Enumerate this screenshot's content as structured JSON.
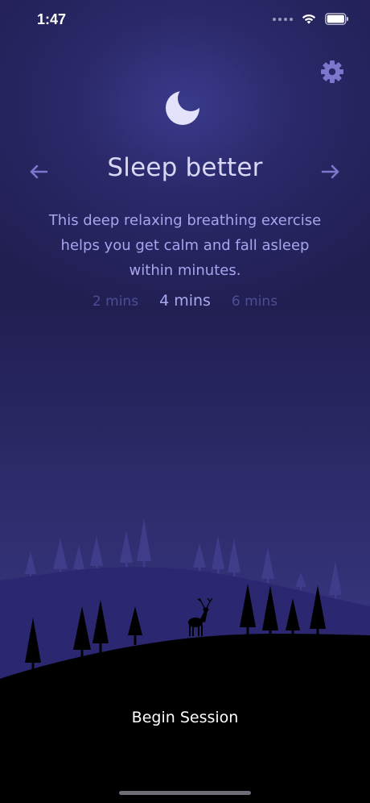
{
  "status_bar": {
    "time": "1:47",
    "icons": [
      "signal-dots-icon",
      "wifi-icon",
      "battery-icon"
    ]
  },
  "header": {
    "settings_icon": "gear-icon",
    "hero_icon": "moon-icon"
  },
  "exercise": {
    "title": "Sleep better",
    "description": "This deep relaxing breathing exercise helps you get calm and fall asleep within minutes.",
    "prev_icon": "arrow-left-icon",
    "next_icon": "arrow-right-icon"
  },
  "durations": {
    "options": [
      "2 mins",
      "4 mins",
      "6 mins"
    ],
    "selected": "4 mins"
  },
  "actions": {
    "begin_label": "Begin Session"
  },
  "colors": {
    "background": "#211f52",
    "title": "#d9d7f4",
    "description": "#a8a4ee",
    "inactive_duration": "#4f4d96",
    "accent_icon": "#7b77cc"
  }
}
